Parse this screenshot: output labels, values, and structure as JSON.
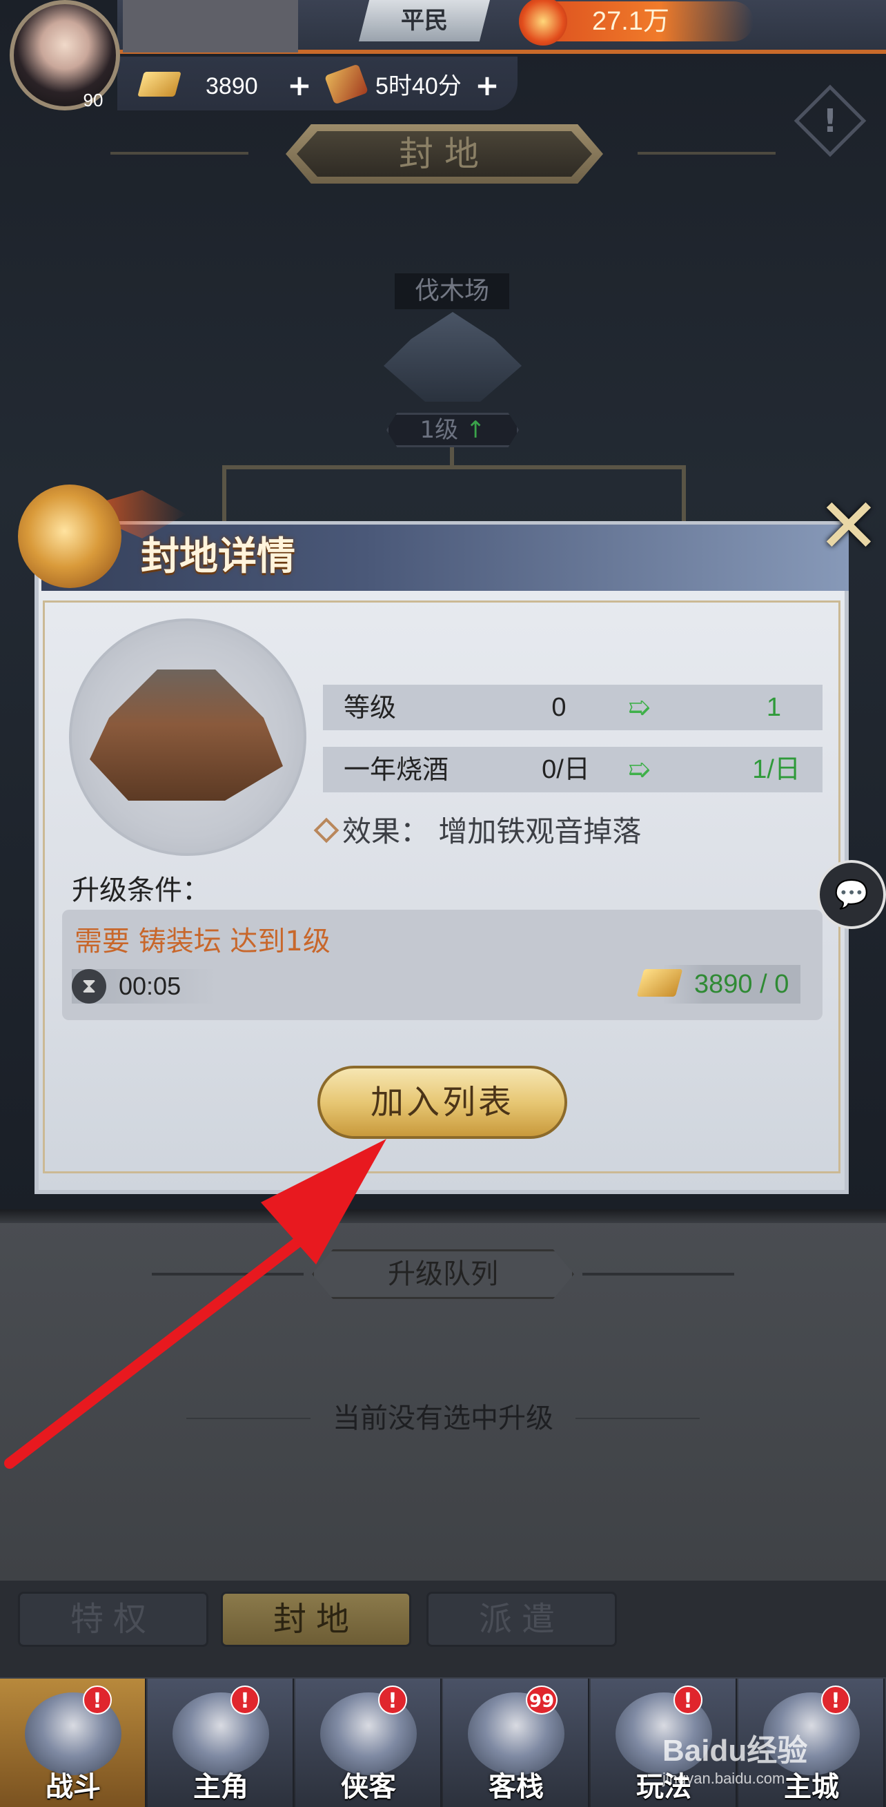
{
  "header": {
    "player_level": "90",
    "rank": "平民",
    "power": "27.1万",
    "gold": "3890",
    "time_resource": "5时40分",
    "icons": {
      "gold": "gold-ingot-icon",
      "scroll": "scroll-icon",
      "warning": "warning-icon",
      "power": "flame-icon"
    }
  },
  "fief": {
    "title": "封地",
    "lumber_yard": {
      "label": "伐木场",
      "level": "1级"
    }
  },
  "modal": {
    "title": "封地详情",
    "stats": [
      {
        "label": "等级",
        "current": "0",
        "next": "1"
      },
      {
        "label": "一年烧酒",
        "current": "0/日",
        "next": "1/日"
      }
    ],
    "effect": "效果：  增加铁观音掉落",
    "conditions_title": "升级条件：",
    "requirement": "需要 铸装坛 达到1级",
    "timer": "00:05",
    "cost": "3890 / 0",
    "add_button": "加入列表"
  },
  "queue": {
    "title": "升级队列",
    "empty_text": "当前没有选中升级"
  },
  "subtabs": [
    {
      "label": "特权",
      "active": false
    },
    {
      "label": "封地",
      "active": true
    },
    {
      "label": "派遣",
      "active": false
    }
  ],
  "nav": [
    {
      "label": "战斗",
      "badge": "!",
      "active": true
    },
    {
      "label": "主角",
      "badge": "!",
      "active": false
    },
    {
      "label": "侠客",
      "badge": "!",
      "active": false
    },
    {
      "label": "客栈",
      "badge": "99",
      "active": false
    },
    {
      "label": "玩法",
      "badge": "!",
      "active": false
    },
    {
      "label": "主城",
      "badge": "!",
      "active": false
    }
  ],
  "watermark": {
    "brand": "Baidu经验",
    "url": "jingyan.baidu.com"
  },
  "colors": {
    "accent_gold": "#e7c774",
    "requirement_orange": "#c8672b",
    "next_value_green": "#2f9a3a",
    "arrow_red": "#e8191f"
  }
}
